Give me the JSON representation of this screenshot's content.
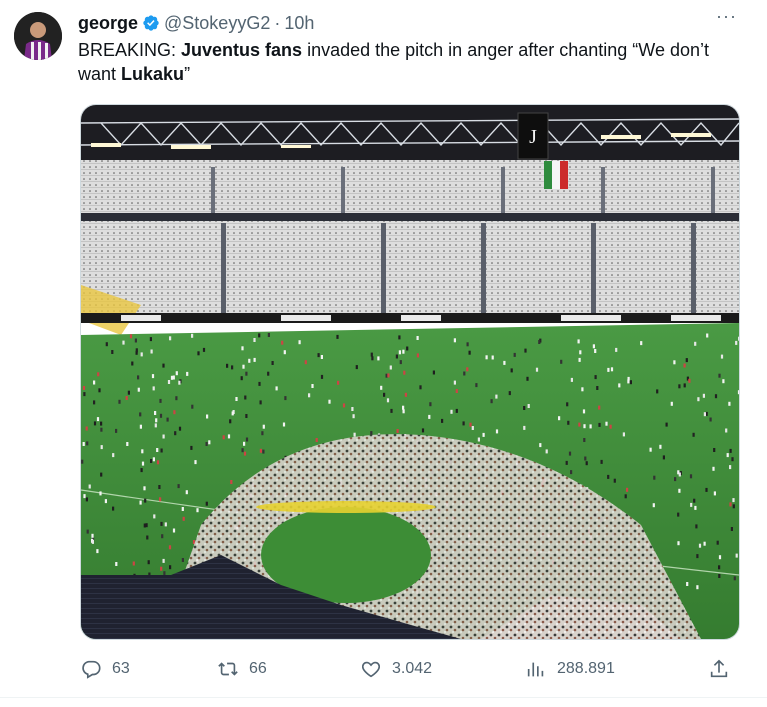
{
  "tweet": {
    "author_name": "george",
    "handle": "@StokeyyG2",
    "separator": "·",
    "time": "10h",
    "more": "···",
    "text_parts": {
      "p1": "BREAKING: ",
      "p2": "Juventus fans",
      "p3": " invaded the pitch in anger after chanting “We don’t want ",
      "p4": "Lukaku",
      "p5": "”"
    }
  },
  "actions": {
    "replies": "63",
    "retweets": "66",
    "likes": "3.042",
    "views": "288.891"
  },
  "colors": {
    "verified": "#1d9bf0",
    "secondary_text": "#536471",
    "pitch": "#3f8f3a"
  },
  "icons": [
    "verified-badge-icon",
    "reply-icon",
    "retweet-icon",
    "like-icon",
    "views-icon",
    "share-icon"
  ]
}
